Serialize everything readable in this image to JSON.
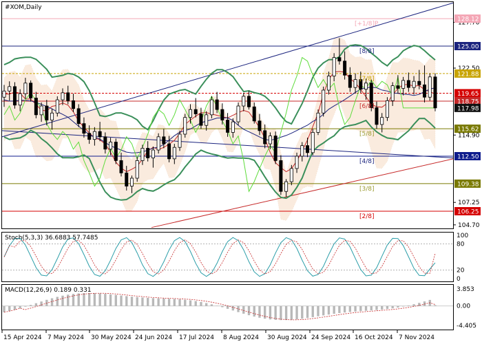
{
  "chart_data": [
    {
      "type": "candlestick",
      "title": "#XOM,Daily",
      "symbol": "#XOM",
      "timeframe": "Daily",
      "x_labels": [
        "15 Apr 2024",
        "7 May 2024",
        "30 May 2024",
        "24 Jun 2024",
        "17 Jul 2024",
        "8 Aug 2024",
        "30 Aug 2024",
        "24 Sep 2024",
        "16 Oct 2024",
        "7 Nov 2024"
      ],
      "y_ticks": [
        "127.70",
        "122.50",
        "114.90",
        "107.25",
        "104.70"
      ],
      "ylim": [
        104.2,
        130.0
      ],
      "price_levels": [
        {
          "label": "128.12",
          "value": 128.12,
          "color": "#f4a6b5",
          "text_color": "#ffffff"
        },
        {
          "label": "125.00",
          "value": 125.0,
          "color": "#1a237e",
          "text_color": "#ffffff"
        },
        {
          "label": "121.88",
          "value": 121.88,
          "color": "#c8a400",
          "text_color": "#ffffff"
        },
        {
          "label": "119.65",
          "value": 119.65,
          "color": "#d50000",
          "text_color": "#ffffff"
        },
        {
          "label": "118.75",
          "value": 118.75,
          "color": "#c62828",
          "text_color": "#ffffff"
        },
        {
          "label": "117.98",
          "value": 117.98,
          "color": "#111111",
          "text_color": "#ffffff"
        },
        {
          "label": "115.62",
          "value": 115.62,
          "color": "#7a7a00",
          "text_color": "#ffffff"
        },
        {
          "label": "112.50",
          "value": 112.5,
          "color": "#0d1b8c",
          "text_color": "#ffffff"
        },
        {
          "label": "109.38",
          "value": 109.38,
          "color": "#7a7a00",
          "text_color": "#ffffff"
        },
        {
          "label": "106.25",
          "value": 106.25,
          "color": "#d50000",
          "text_color": "#ffffff"
        }
      ],
      "murrey_labels": [
        {
          "label": "[+1/8]P",
          "value": 128.12,
          "color": "#f4a6b5"
        },
        {
          "label": "[8/8]",
          "value": 125.0,
          "color": "#1a237e"
        },
        {
          "label": "[7/8]",
          "value": 121.88,
          "color": "#c8a400"
        },
        {
          "label": "[6/8]",
          "value": 118.75,
          "color": "#c62828"
        },
        {
          "label": "[5/8]",
          "value": 115.62,
          "color": "#9a9a30"
        },
        {
          "label": "[4/8]",
          "value": 112.5,
          "color": "#1a237e"
        },
        {
          "label": "[3/8]",
          "value": 109.38,
          "color": "#9a9a30"
        },
        {
          "label": "[2/8]",
          "value": 106.25,
          "color": "#d50000"
        }
      ],
      "candles": [
        {
          "o": 119.2,
          "h": 120.6,
          "l": 118.1,
          "c": 119.9
        },
        {
          "o": 119.9,
          "h": 121.0,
          "l": 118.8,
          "c": 120.4
        },
        {
          "o": 120.4,
          "h": 120.9,
          "l": 117.9,
          "c": 118.3
        },
        {
          "o": 118.3,
          "h": 120.1,
          "l": 117.6,
          "c": 119.6
        },
        {
          "o": 119.6,
          "h": 121.4,
          "l": 119.0,
          "c": 120.8
        },
        {
          "o": 120.8,
          "h": 121.1,
          "l": 118.7,
          "c": 119.1
        },
        {
          "o": 119.1,
          "h": 119.8,
          "l": 116.8,
          "c": 117.2
        },
        {
          "o": 117.2,
          "h": 118.6,
          "l": 116.4,
          "c": 118.2
        },
        {
          "o": 118.2,
          "h": 118.9,
          "l": 116.0,
          "c": 116.6
        },
        {
          "o": 116.6,
          "h": 117.9,
          "l": 115.5,
          "c": 117.4
        },
        {
          "o": 117.4,
          "h": 119.3,
          "l": 117.0,
          "c": 118.9
        },
        {
          "o": 118.9,
          "h": 120.2,
          "l": 118.3,
          "c": 119.7
        },
        {
          "o": 119.7,
          "h": 120.5,
          "l": 118.4,
          "c": 118.8
        },
        {
          "o": 118.8,
          "h": 119.6,
          "l": 117.5,
          "c": 117.9
        },
        {
          "o": 117.9,
          "h": 118.4,
          "l": 115.8,
          "c": 116.2
        },
        {
          "o": 116.2,
          "h": 116.9,
          "l": 114.6,
          "c": 115.1
        },
        {
          "o": 115.1,
          "h": 116.0,
          "l": 113.9,
          "c": 114.4
        },
        {
          "o": 114.4,
          "h": 115.8,
          "l": 113.7,
          "c": 115.3
        },
        {
          "o": 115.3,
          "h": 116.4,
          "l": 114.2,
          "c": 114.7
        },
        {
          "o": 114.7,
          "h": 115.2,
          "l": 112.8,
          "c": 113.3
        },
        {
          "o": 113.3,
          "h": 114.6,
          "l": 112.6,
          "c": 114.1
        },
        {
          "o": 114.1,
          "h": 114.5,
          "l": 111.6,
          "c": 112.0
        },
        {
          "o": 112.0,
          "h": 112.9,
          "l": 110.2,
          "c": 110.6
        },
        {
          "o": 110.6,
          "h": 111.4,
          "l": 108.6,
          "c": 109.1
        },
        {
          "o": 109.1,
          "h": 110.3,
          "l": 108.3,
          "c": 110.0
        },
        {
          "o": 110.0,
          "h": 112.4,
          "l": 109.6,
          "c": 112.0
        },
        {
          "o": 112.0,
          "h": 113.8,
          "l": 111.5,
          "c": 113.4
        },
        {
          "o": 113.4,
          "h": 114.2,
          "l": 111.9,
          "c": 112.3
        },
        {
          "o": 112.3,
          "h": 113.6,
          "l": 111.2,
          "c": 113.2
        },
        {
          "o": 113.2,
          "h": 115.1,
          "l": 112.8,
          "c": 114.7
        },
        {
          "o": 114.7,
          "h": 115.6,
          "l": 113.4,
          "c": 113.9
        },
        {
          "o": 113.9,
          "h": 114.8,
          "l": 111.8,
          "c": 112.2
        },
        {
          "o": 112.2,
          "h": 113.9,
          "l": 111.6,
          "c": 113.5
        },
        {
          "o": 113.5,
          "h": 115.4,
          "l": 113.1,
          "c": 115.0
        },
        {
          "o": 115.0,
          "h": 117.3,
          "l": 114.6,
          "c": 116.9
        },
        {
          "o": 116.9,
          "h": 118.4,
          "l": 116.2,
          "c": 117.8
        },
        {
          "o": 117.8,
          "h": 119.1,
          "l": 116.9,
          "c": 117.3
        },
        {
          "o": 117.3,
          "h": 118.0,
          "l": 115.6,
          "c": 116.0
        },
        {
          "o": 116.0,
          "h": 117.6,
          "l": 115.4,
          "c": 117.2
        },
        {
          "o": 117.2,
          "h": 119.3,
          "l": 116.8,
          "c": 118.9
        },
        {
          "o": 118.9,
          "h": 119.8,
          "l": 117.4,
          "c": 117.8
        },
        {
          "o": 117.8,
          "h": 118.5,
          "l": 116.1,
          "c": 116.6
        },
        {
          "o": 116.6,
          "h": 117.4,
          "l": 114.7,
          "c": 115.2
        },
        {
          "o": 115.2,
          "h": 116.8,
          "l": 114.6,
          "c": 116.4
        },
        {
          "o": 116.4,
          "h": 118.6,
          "l": 116.0,
          "c": 118.2
        },
        {
          "o": 118.2,
          "h": 119.7,
          "l": 117.6,
          "c": 119.3
        },
        {
          "o": 119.3,
          "h": 119.9,
          "l": 117.8,
          "c": 118.1
        },
        {
          "o": 118.1,
          "h": 118.6,
          "l": 116.2,
          "c": 116.5
        },
        {
          "o": 116.5,
          "h": 117.3,
          "l": 114.9,
          "c": 115.4
        },
        {
          "o": 115.4,
          "h": 116.1,
          "l": 113.4,
          "c": 113.9
        },
        {
          "o": 113.9,
          "h": 115.2,
          "l": 113.3,
          "c": 114.8
        },
        {
          "o": 114.8,
          "h": 115.3,
          "l": 111.6,
          "c": 112.0
        },
        {
          "o": 112.0,
          "h": 112.6,
          "l": 108.1,
          "c": 108.5
        },
        {
          "o": 108.5,
          "h": 109.9,
          "l": 107.9,
          "c": 109.6
        },
        {
          "o": 109.6,
          "h": 111.5,
          "l": 109.2,
          "c": 111.1
        },
        {
          "o": 111.1,
          "h": 112.9,
          "l": 110.6,
          "c": 112.5
        },
        {
          "o": 112.5,
          "h": 114.1,
          "l": 111.9,
          "c": 113.7
        },
        {
          "o": 113.7,
          "h": 114.6,
          "l": 112.4,
          "c": 112.9
        },
        {
          "o": 112.9,
          "h": 115.6,
          "l": 112.6,
          "c": 115.2
        },
        {
          "o": 115.2,
          "h": 117.8,
          "l": 114.9,
          "c": 117.4
        },
        {
          "o": 117.4,
          "h": 120.4,
          "l": 117.0,
          "c": 120.0
        },
        {
          "o": 120.0,
          "h": 122.1,
          "l": 119.5,
          "c": 121.6
        },
        {
          "o": 121.6,
          "h": 124.2,
          "l": 121.0,
          "c": 123.7
        },
        {
          "o": 123.7,
          "h": 125.9,
          "l": 122.9,
          "c": 123.3
        },
        {
          "o": 123.3,
          "h": 124.4,
          "l": 121.2,
          "c": 121.7
        },
        {
          "o": 121.7,
          "h": 122.6,
          "l": 119.8,
          "c": 120.3
        },
        {
          "o": 120.3,
          "h": 121.9,
          "l": 119.6,
          "c": 121.2
        },
        {
          "o": 121.2,
          "h": 122.1,
          "l": 119.7,
          "c": 120.1
        },
        {
          "o": 120.1,
          "h": 121.3,
          "l": 118.9,
          "c": 120.8
        },
        {
          "o": 120.8,
          "h": 121.2,
          "l": 117.6,
          "c": 118.0
        },
        {
          "o": 118.0,
          "h": 118.7,
          "l": 115.6,
          "c": 116.1
        },
        {
          "o": 116.1,
          "h": 117.4,
          "l": 115.2,
          "c": 116.9
        },
        {
          "o": 116.9,
          "h": 119.2,
          "l": 116.5,
          "c": 118.8
        },
        {
          "o": 118.8,
          "h": 120.9,
          "l": 118.2,
          "c": 120.5
        },
        {
          "o": 120.5,
          "h": 121.7,
          "l": 119.6,
          "c": 120.2
        },
        {
          "o": 120.2,
          "h": 121.5,
          "l": 119.4,
          "c": 121.1
        },
        {
          "o": 121.1,
          "h": 122.0,
          "l": 119.8,
          "c": 120.3
        },
        {
          "o": 120.3,
          "h": 121.6,
          "l": 119.5,
          "c": 121.0
        },
        {
          "o": 121.0,
          "h": 122.3,
          "l": 120.1,
          "c": 120.6
        },
        {
          "o": 120.6,
          "h": 122.8,
          "l": 118.6,
          "c": 119.2
        },
        {
          "o": 119.2,
          "h": 121.9,
          "l": 118.8,
          "c": 121.5
        },
        {
          "o": 121.5,
          "h": 121.9,
          "l": 117.6,
          "c": 117.98
        }
      ],
      "stoch": {
        "label": "Stoch(5,3,3) 36.6883 57.7485",
        "k": 36.6883,
        "d": 57.7485,
        "y_ticks": [
          "100",
          "80",
          "20",
          "0"
        ]
      },
      "macd": {
        "label": "MACD(12,26,9) 0.189 0.331",
        "main": 0.189,
        "signal": 0.331,
        "y_ticks": [
          "3.853",
          "0.00",
          "-4.405"
        ]
      }
    }
  ]
}
